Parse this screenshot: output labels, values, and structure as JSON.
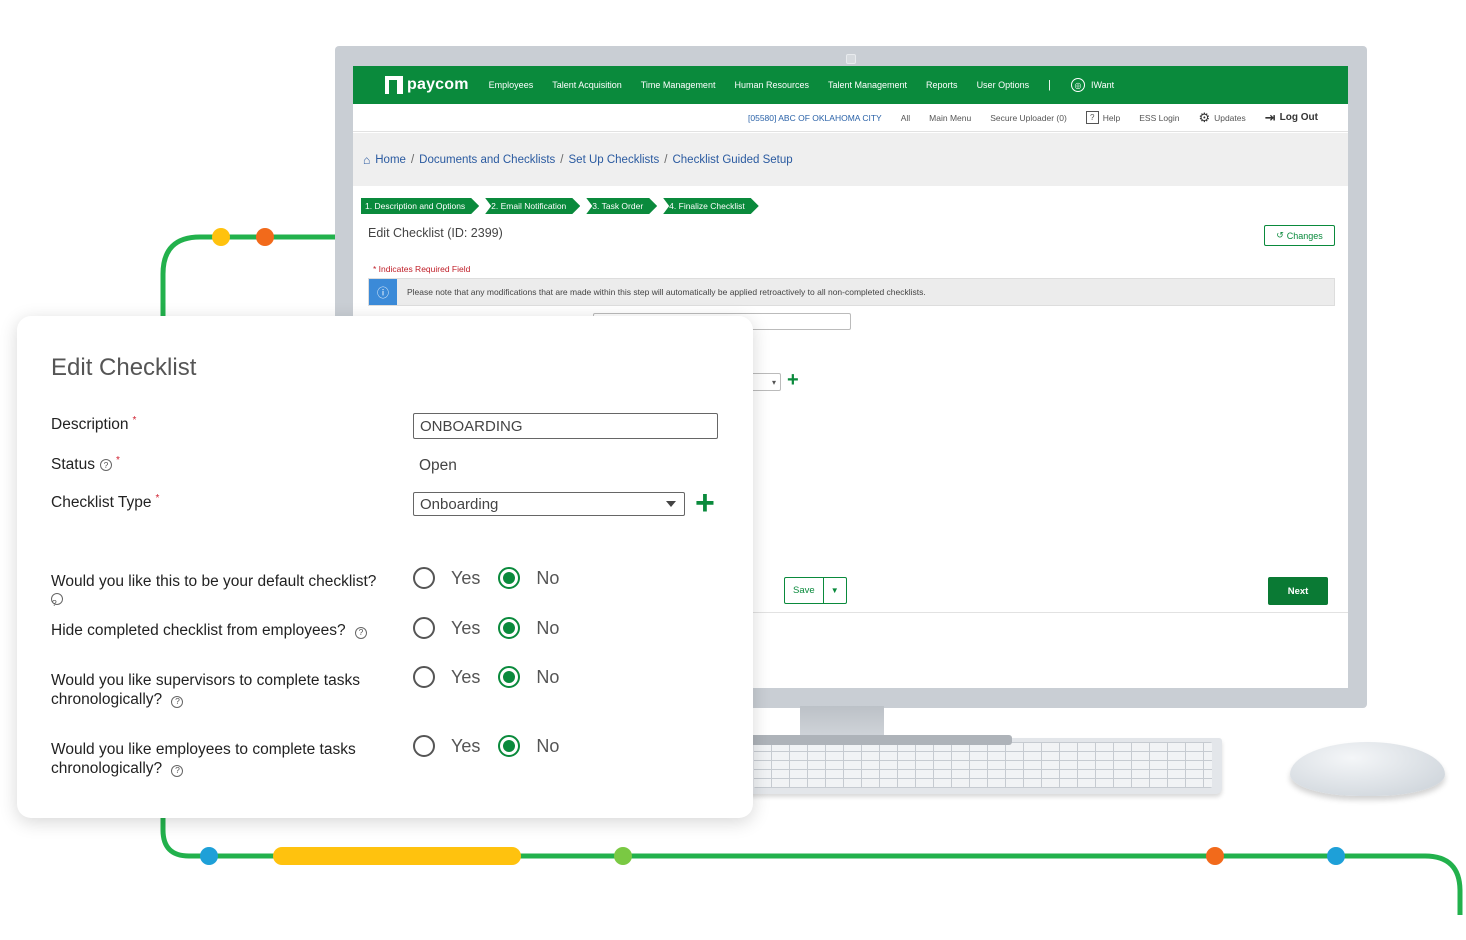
{
  "nav": {
    "logo": "paycom",
    "items": [
      "Employees",
      "Talent Acquisition",
      "Time Management",
      "Human Resources",
      "Talent Management",
      "Reports",
      "User Options"
    ],
    "separator": "|",
    "iwant": "IWant"
  },
  "subbar": {
    "company": "[05580] ABC OF OKLAHOMA CITY",
    "all": "All",
    "main_menu": "Main Menu",
    "secure_uploader": "Secure Uploader (0)",
    "help": "Help",
    "ess_login": "ESS Login",
    "updates": "Updates",
    "logout": "Log Out"
  },
  "breadcrumb": [
    "Home",
    "Documents and Checklists",
    "Set Up Checklists",
    "Checklist Guided Setup"
  ],
  "steps": [
    "1. Description and Options",
    "2. Email Notification",
    "3. Task Order",
    "4. Finalize Checklist"
  ],
  "page": {
    "edit_title": "Edit Checklist (ID: 2399)",
    "changes_label": "Changes",
    "required_note": "* Indicates Required Field",
    "info_message": "Please note that any modifications that are made within this step will automatically be applied retroactively to all non-completed checklists.",
    "save_label": "Save",
    "next_label": "Next"
  },
  "card": {
    "title": "Edit Checklist",
    "description_label": "Description",
    "description_value": "ONBOARDING",
    "status_label": "Status",
    "status_value": "Open",
    "type_label": "Checklist Type",
    "type_value": "Onboarding",
    "questions": [
      {
        "text": "Would you like this to be your default checklist?",
        "selected": "No"
      },
      {
        "text": "Hide completed checklist from employees?",
        "selected": "No"
      },
      {
        "text": "Would you like supervisors to complete tasks chronologically?",
        "selected": "No"
      },
      {
        "text": "Would you like employees to complete tasks chronologically?",
        "selected": "No"
      }
    ],
    "yes_label": "Yes",
    "no_label": "No"
  },
  "colors": {
    "brand_green": "#0a8a3c",
    "track_green": "#22b14c",
    "track_yellow": "#ffc20e",
    "track_orange": "#f26a1b",
    "track_blue": "#1ea0d8",
    "track_lime": "#7ac943"
  }
}
